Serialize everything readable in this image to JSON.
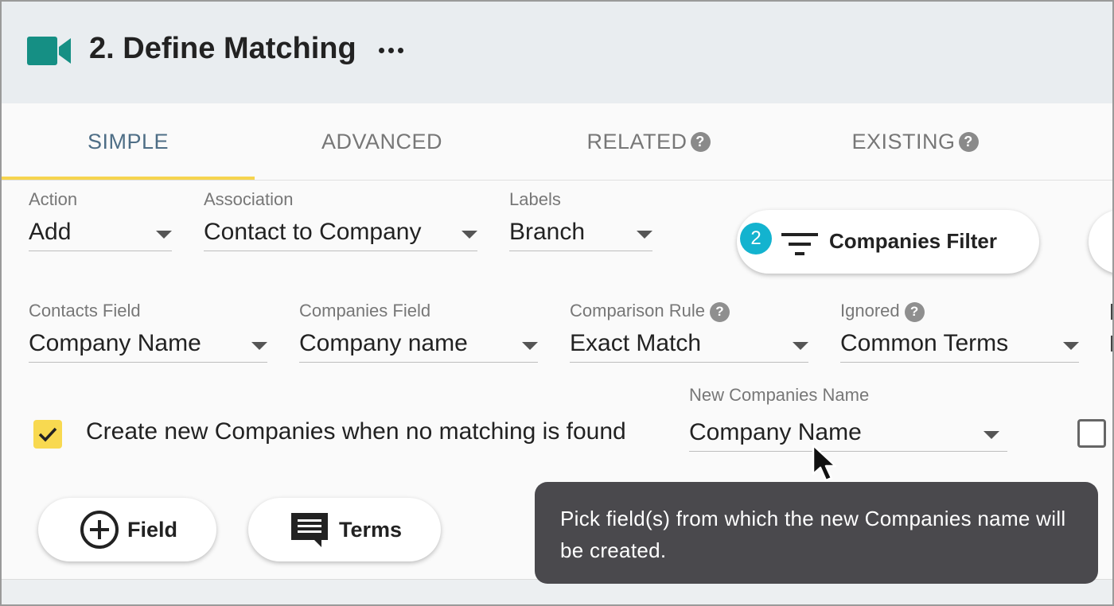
{
  "header": {
    "title": "2. Define Matching",
    "icon": "video-camera-icon",
    "accent": "#158f84"
  },
  "tabs": [
    {
      "label": "SIMPLE",
      "active": true
    },
    {
      "label": "ADVANCED"
    },
    {
      "label": "RELATED",
      "help": true
    },
    {
      "label": "EXISTING",
      "help": true
    }
  ],
  "help_glyph": "?",
  "row1": {
    "action": {
      "label": "Action",
      "value": "Add"
    },
    "association": {
      "label": "Association",
      "value": "Contact to Company"
    },
    "labels": {
      "label": "Labels",
      "value": "Branch"
    }
  },
  "filter_button": {
    "badge": "2",
    "label": "Companies Filter",
    "badge_color": "#13b3cf"
  },
  "row2": {
    "contacts_field": {
      "label": "Contacts Field",
      "value": "Company Name"
    },
    "companies_field": {
      "label": "Companies Field",
      "value": "Company name"
    },
    "comparison_rule": {
      "label": "Comparison Rule",
      "value": "Exact Match"
    },
    "ignored": {
      "label": "Ignored",
      "value": "Common Terms"
    }
  },
  "create_new": {
    "checked": true,
    "label": "Create new Companies when no matching is found",
    "checkbox_color": "#f8d950"
  },
  "new_name": {
    "label": "New Companies Name",
    "value": "Company Name"
  },
  "buttons": {
    "field": "Field",
    "terms": "Terms"
  },
  "tooltip": {
    "text": "Pick field(s) from which the new Companies name will be created."
  }
}
